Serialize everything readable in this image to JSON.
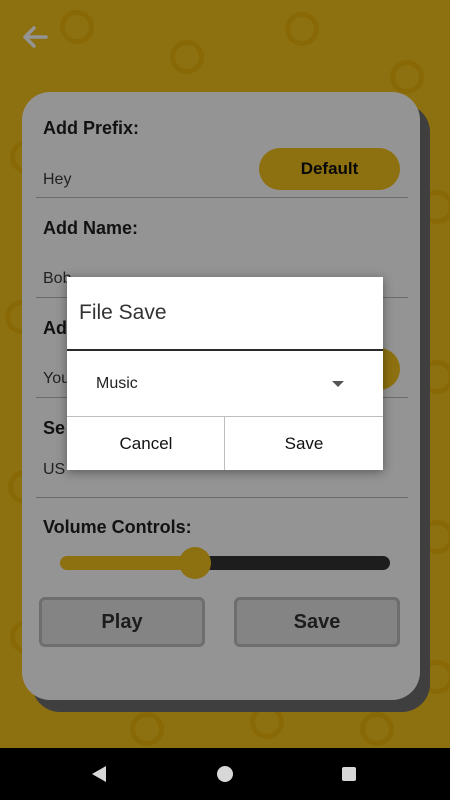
{
  "colors": {
    "accent": "#f3c21a",
    "track_dark": "#333333",
    "card": "#ffffff"
  },
  "header": {
    "back_icon": "arrow-left-icon"
  },
  "form": {
    "prefix": {
      "title": "Add Prefix:",
      "value": "Hey",
      "button": "Default"
    },
    "name": {
      "title": "Add Name:",
      "value": "Bob"
    },
    "third": {
      "title": "Ad",
      "value": "You"
    },
    "fourth": {
      "title": "Se",
      "value": "US"
    },
    "volume": {
      "title": "Volume Controls:",
      "level": 0.41
    },
    "buttons": {
      "play": "Play",
      "save": "Save"
    }
  },
  "dialog": {
    "title": "File Save",
    "selected": "Music",
    "cancel": "Cancel",
    "save": "Save"
  },
  "navbar": {
    "icons": [
      "back-icon",
      "home-icon",
      "recents-icon"
    ]
  }
}
